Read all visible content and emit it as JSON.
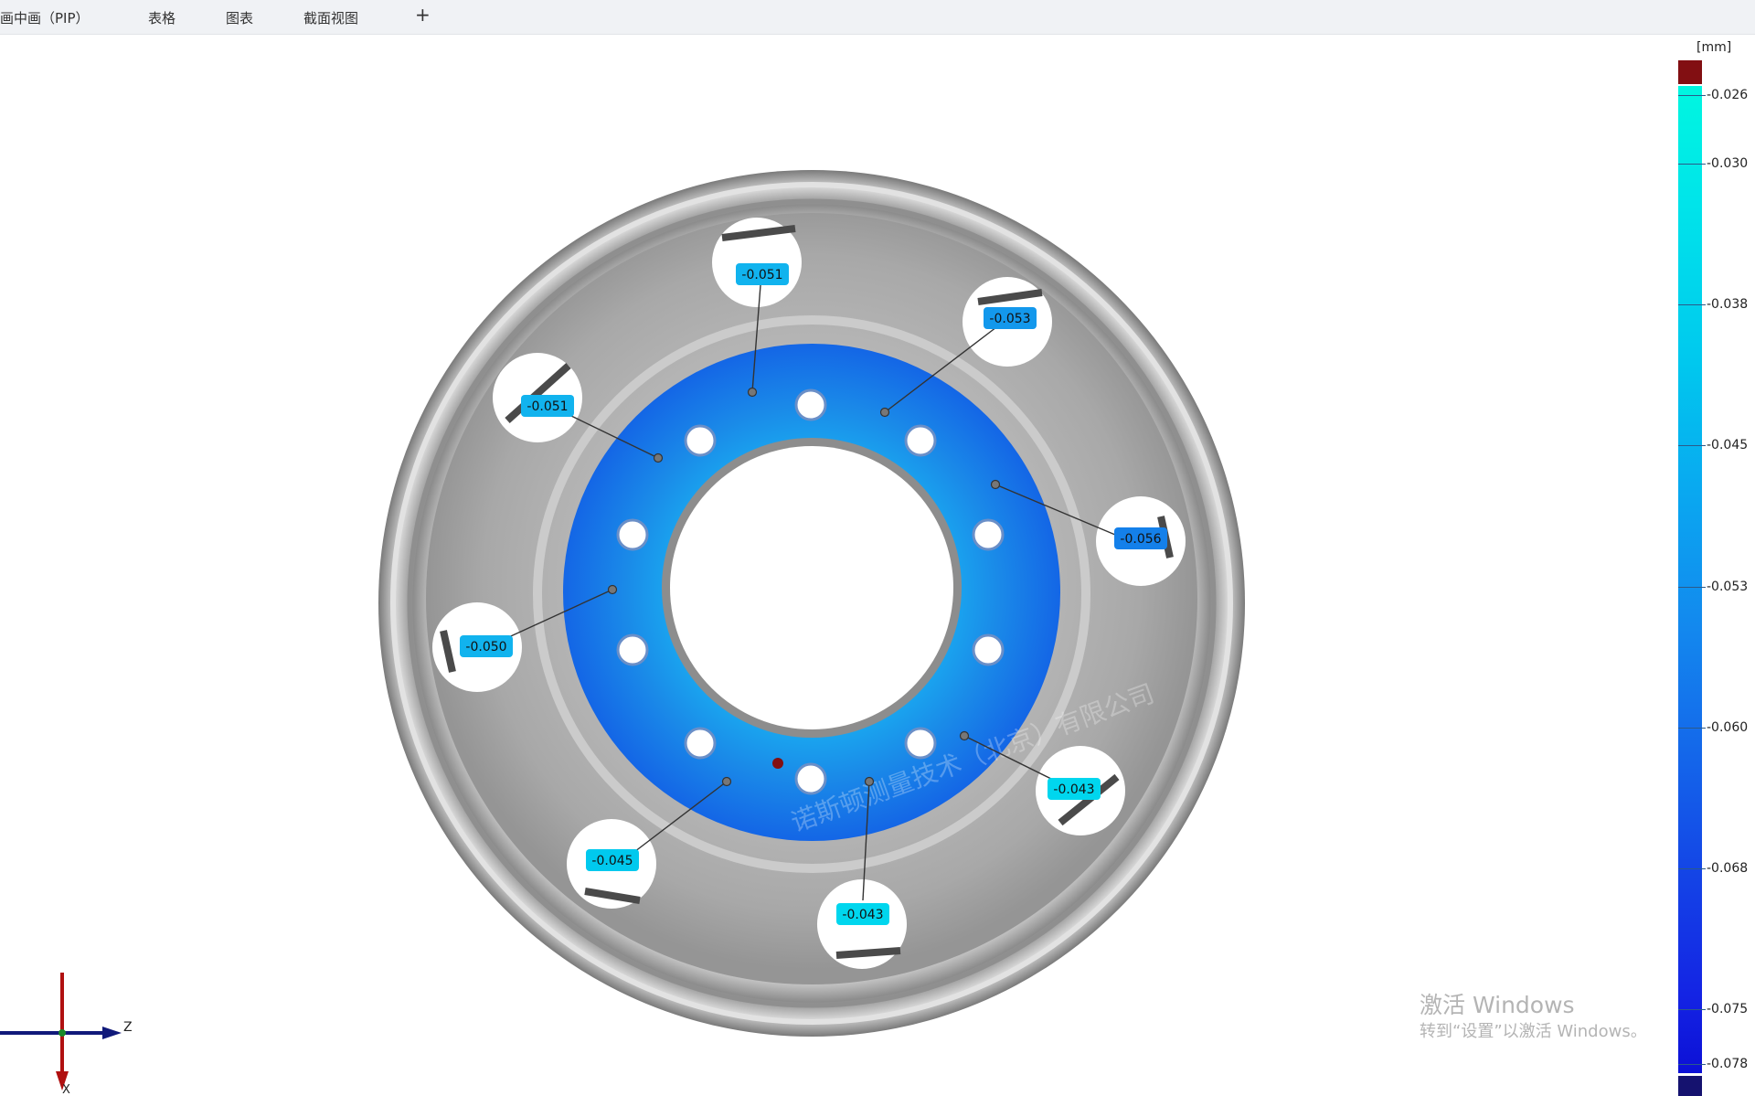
{
  "tabs": [
    {
      "label": "画中画（PIP）"
    },
    {
      "label": "表格"
    },
    {
      "label": "图表"
    },
    {
      "label": "截面视图"
    },
    {
      "label": "+"
    }
  ],
  "annotations": [
    {
      "value": "-0.051"
    },
    {
      "value": "-0.053"
    },
    {
      "value": "-0.051"
    },
    {
      "value": "-0.056"
    },
    {
      "value": "-0.050"
    },
    {
      "value": "-0.043"
    },
    {
      "value": "-0.045"
    },
    {
      "value": "-0.043"
    }
  ],
  "legend": {
    "unit": "[mm]",
    "ticks": [
      "-0.026",
      "-0.030",
      "-0.038",
      "-0.045",
      "-0.053",
      "-0.060",
      "-0.068",
      "-0.075",
      "-0.078"
    ],
    "colors": {
      "over": "#820f12",
      "under": "#15126f",
      "top": "#00f6e0",
      "bottom": "#0c10d6"
    }
  },
  "axes": {
    "z_label": "Z",
    "x_label": "X"
  },
  "watermark": {
    "company": "诺斯顿测量技术（北京）有限公司",
    "windows_line1": "激活 Windows",
    "windows_line2": "转到“设置”以激活 Windows。"
  }
}
